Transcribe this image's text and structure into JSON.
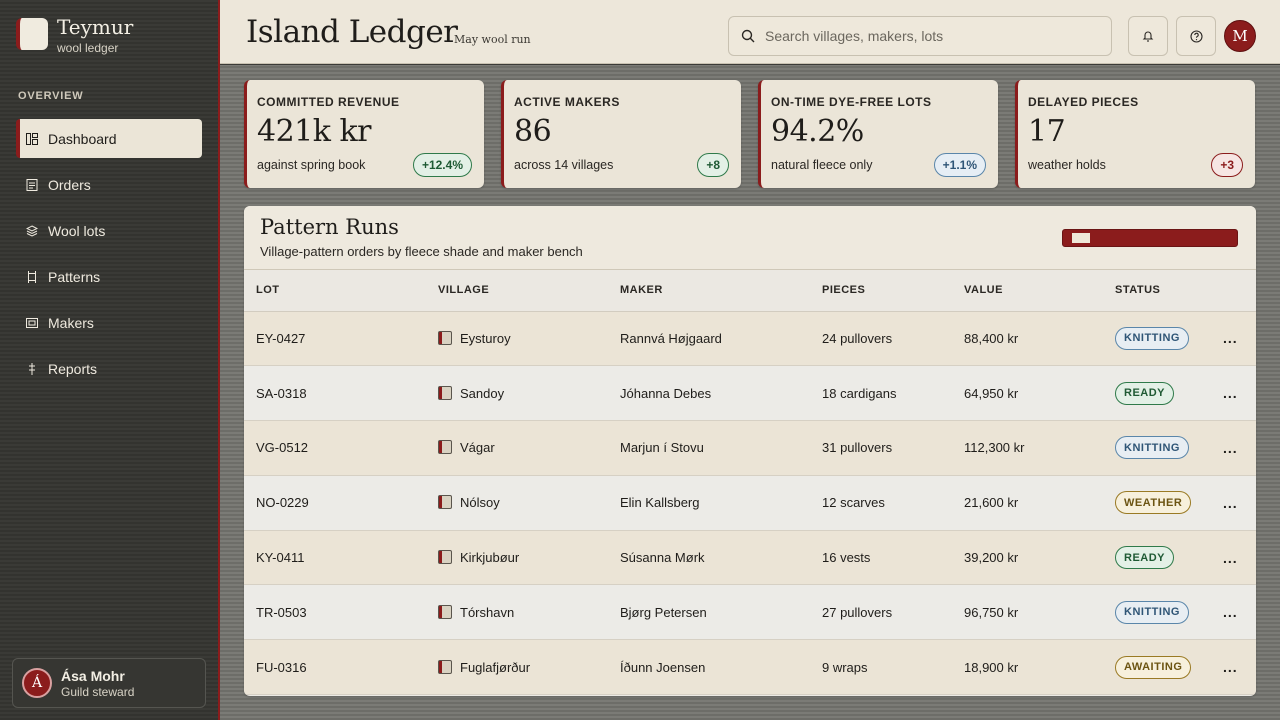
{
  "brand": {
    "name": "Teymur",
    "sub": "wool ledger"
  },
  "sidebar": {
    "section": "OVERVIEW",
    "items": [
      {
        "label": "Dashboard",
        "icon": "dashboard-icon",
        "active": true
      },
      {
        "label": "Orders",
        "icon": "orders-icon"
      },
      {
        "label": "Wool lots",
        "icon": "layers-icon"
      },
      {
        "label": "Patterns",
        "icon": "pattern-icon"
      },
      {
        "label": "Makers",
        "icon": "makers-icon"
      },
      {
        "label": "Reports",
        "icon": "reports-icon"
      }
    ],
    "user": {
      "initial": "Á",
      "name": "Ása Mohr",
      "role": "Guild steward"
    }
  },
  "header": {
    "title": "Island Ledger",
    "subtitle": "May wool run",
    "search_placeholder": "Search villages, makers, lots",
    "avatar_initial": "M"
  },
  "kpis": [
    {
      "label": "COMMITTED REVENUE",
      "value": "421k kr",
      "note": "against spring book",
      "badge": "+12.4%",
      "tone": "green"
    },
    {
      "label": "ACTIVE MAKERS",
      "value": "86",
      "note": "across 14 villages",
      "badge": "+8",
      "tone": "green"
    },
    {
      "label": "ON-TIME DYE-FREE LOTS",
      "value": "94.2%",
      "note": "natural fleece only",
      "badge": "+1.1%",
      "tone": "blue"
    },
    {
      "label": "DELAYED PIECES",
      "value": "17",
      "note": "weather holds",
      "badge": "+3",
      "tone": "red"
    }
  ],
  "panel": {
    "title": "Pattern Runs",
    "subtitle": "Village-pattern orders by fleece shade and maker bench",
    "progress": 0.12,
    "columns": [
      "LOT",
      "VILLAGE",
      "MAKER",
      "PIECES",
      "VALUE",
      "STATUS"
    ],
    "more_label": "...",
    "rows": [
      {
        "lot": "EY-0427",
        "village": "Eysturoy",
        "maker": "Rannvá Højgaard",
        "pieces": "24 pullovers",
        "value": "88,400 kr",
        "status": "KNITTING"
      },
      {
        "lot": "SA-0318",
        "village": "Sandoy",
        "maker": "Jóhanna Debes",
        "pieces": "18 cardigans",
        "value": "64,950 kr",
        "status": "READY"
      },
      {
        "lot": "VG-0512",
        "village": "Vágar",
        "maker": "Marjun í Stovu",
        "pieces": "31 pullovers",
        "value": "112,300 kr",
        "status": "KNITTING"
      },
      {
        "lot": "NO-0229",
        "village": "Nólsoy",
        "maker": "Elin Kallsberg",
        "pieces": "12 scarves",
        "value": "21,600 kr",
        "status": "WEATHER"
      },
      {
        "lot": "KY-0411",
        "village": "Kirkjubøur",
        "maker": "Súsanna Mørk",
        "pieces": "16 vests",
        "value": "39,200 kr",
        "status": "READY"
      },
      {
        "lot": "TR-0503",
        "village": "Tórshavn",
        "maker": "Bjørg Petersen",
        "pieces": "27 pullovers",
        "value": "96,750 kr",
        "status": "KNITTING"
      },
      {
        "lot": "FU-0316",
        "village": "Fuglafjørður",
        "maker": "Íðunn Joensen",
        "pieces": "9 wraps",
        "value": "18,900 kr",
        "status": "AWAITING"
      }
    ]
  },
  "colors": {
    "accent": "#8b1c1c",
    "paper": "#ebe5d8"
  }
}
